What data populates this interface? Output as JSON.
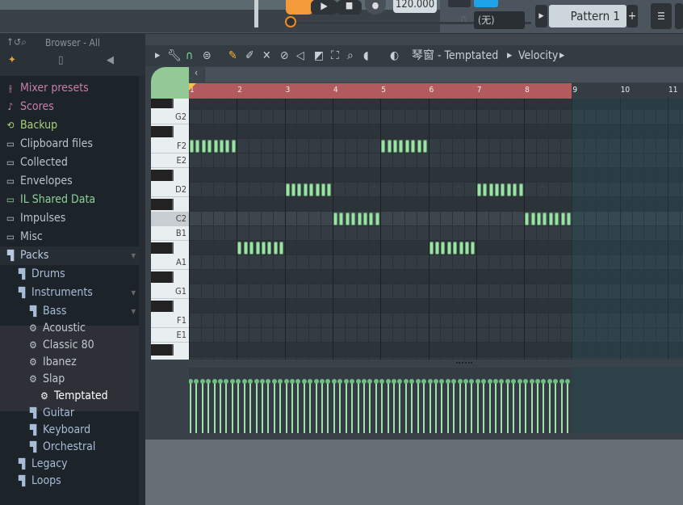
{
  "topbar": {
    "tempo": "120.000",
    "snap": "(无)",
    "pattern": "Pattern 1",
    "add_pattern": "+"
  },
  "browser": {
    "title": "Browser - All",
    "items": [
      {
        "label": "Mixer presets",
        "icon": "mixer-icon",
        "color": "#c77fa8",
        "indent": 0
      },
      {
        "label": "Scores",
        "icon": "note-icon",
        "color": "#c77fa8",
        "indent": 0
      },
      {
        "label": "Backup",
        "icon": "backup-folder-icon",
        "color": "#a8d07a",
        "indent": 0
      },
      {
        "label": "Clipboard files",
        "icon": "folder-icon",
        "color": "#b8c3cc",
        "indent": 0
      },
      {
        "label": "Collected",
        "icon": "folder-icon",
        "color": "#b8c3cc",
        "indent": 0
      },
      {
        "label": "Envelopes",
        "icon": "folder-icon",
        "color": "#b8c3cc",
        "indent": 0
      },
      {
        "label": "IL Shared Data",
        "icon": "shared-folder-icon",
        "color": "#8fcf9b",
        "indent": 0
      },
      {
        "label": "Impulses",
        "icon": "folder-icon",
        "color": "#b8c3cc",
        "indent": 0
      },
      {
        "label": "Misc",
        "icon": "folder-icon",
        "color": "#b8c3cc",
        "indent": 0
      },
      {
        "label": "Packs",
        "icon": "pack-icon",
        "color": "#b8c9e0",
        "indent": 0,
        "expanded": true
      },
      {
        "label": "Drums",
        "icon": "pack-icon",
        "color": "#a7bcd9",
        "indent": 1
      },
      {
        "label": "Instruments",
        "icon": "pack-icon",
        "color": "#a7bcd9",
        "indent": 1,
        "expanded": true
      },
      {
        "label": "Bass",
        "icon": "pack-icon",
        "color": "#a7bcd9",
        "indent": 2,
        "expanded": true
      },
      {
        "label": "Acoustic",
        "icon": "preset-gear-icon",
        "color": "#c2c8cd",
        "indent": 2
      },
      {
        "label": "Classic 80",
        "icon": "preset-gear-icon",
        "color": "#c2c8cd",
        "indent": 2
      },
      {
        "label": "Ibanez",
        "icon": "preset-gear-icon",
        "color": "#c2c8cd",
        "indent": 2
      },
      {
        "label": "Slap",
        "icon": "preset-gear-icon",
        "color": "#c2c8cd",
        "indent": 2
      },
      {
        "label": "Temptated",
        "icon": "preset-gear-icon",
        "color": "#ffffff",
        "indent": 3,
        "selected": true
      },
      {
        "label": "Guitar",
        "icon": "pack-icon",
        "color": "#a7bcd9",
        "indent": 2
      },
      {
        "label": "Keyboard",
        "icon": "pack-icon",
        "color": "#a7bcd9",
        "indent": 2
      },
      {
        "label": "Orchestral",
        "icon": "pack-icon",
        "color": "#a7bcd9",
        "indent": 2
      },
      {
        "label": "Legacy",
        "icon": "pack-icon",
        "color": "#a7bcd9",
        "indent": 1
      },
      {
        "label": "Loops",
        "icon": "pack-icon",
        "color": "#a7bcd9",
        "indent": 1
      }
    ]
  },
  "piano_roll": {
    "title": "琴窗 - Temptated",
    "target": "Velocity",
    "bar_labels": [
      "1",
      "2",
      "3",
      "4",
      "5",
      "6",
      "7",
      "8",
      "9",
      "10",
      "11"
    ],
    "key_labels": [
      "G2",
      "F2",
      "E2",
      "D2",
      "C2",
      "B1",
      "A1",
      "G1",
      "F1",
      "E1"
    ],
    "notes_per_bar": 8,
    "bar_pitches": [
      "F2",
      "A#1",
      "D2",
      "C2",
      "F2",
      "A#1",
      "D2",
      "C2"
    ],
    "note_color": "#9fe0a8",
    "ruler_color": "#b35a5e",
    "accent": "#f08a24"
  }
}
